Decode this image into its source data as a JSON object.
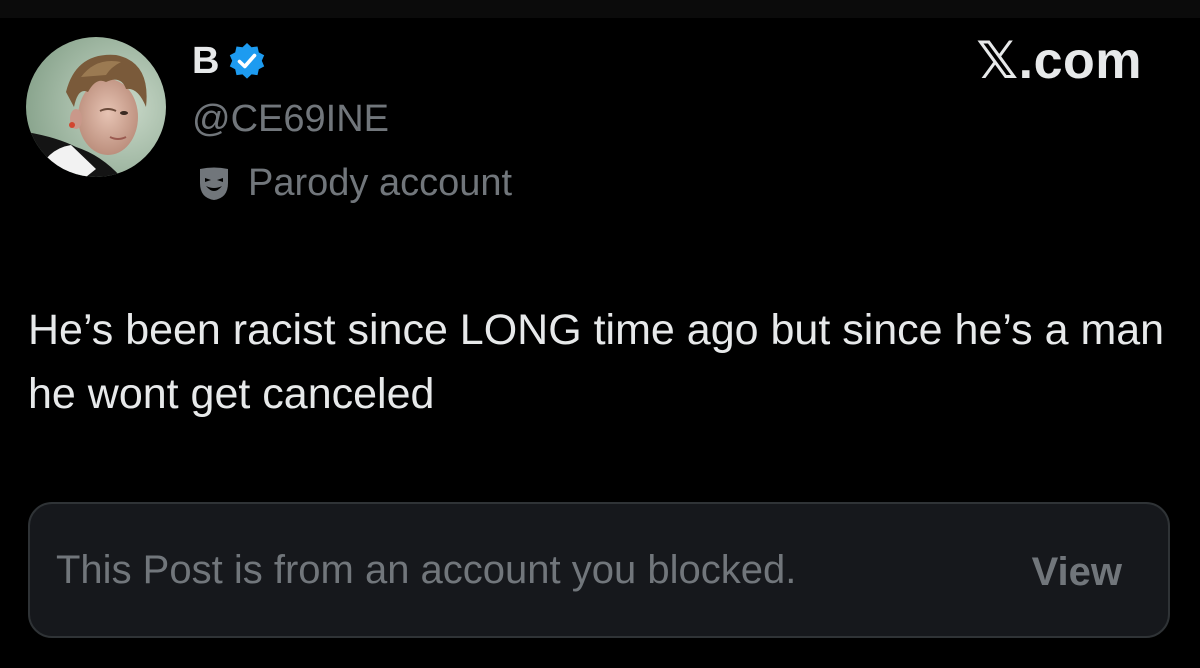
{
  "post": {
    "display_name": "B",
    "handle": "@CE69INE",
    "account_label": "Parody account",
    "verified_icon": "verified-badge-icon",
    "label_icon": "theater-mask-icon",
    "text": "He’s been racist since LONG time ago but since he’s a man he wont get canceled"
  },
  "brand": {
    "text": "𝕏.com"
  },
  "blocked_notice": {
    "message": "This Post is from an account you blocked.",
    "action_label": "View"
  },
  "colors": {
    "background": "#000000",
    "primary_text": "#e7e9ea",
    "secondary_text": "#71767b",
    "verified_blue": "#1d9bf0",
    "notice_background": "#16181c",
    "notice_border": "#2f3336"
  }
}
